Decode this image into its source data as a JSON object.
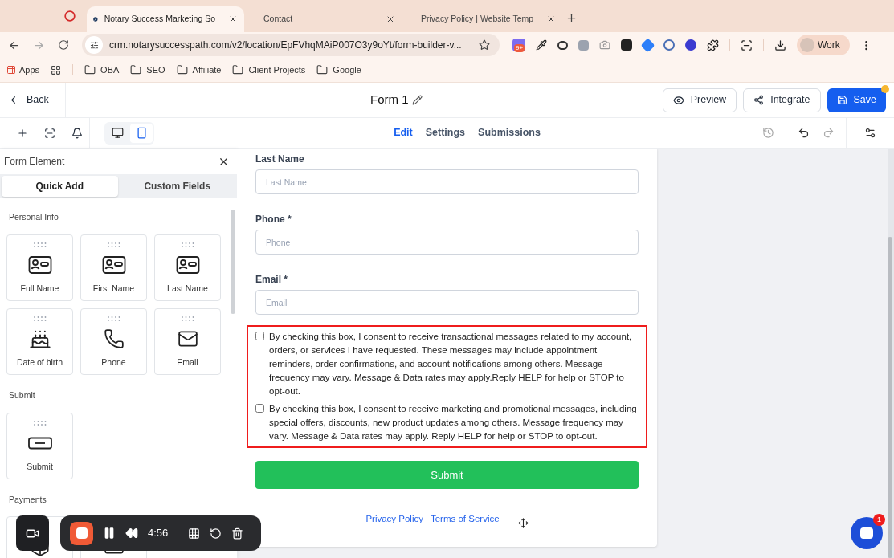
{
  "browser": {
    "tabs": [
      {
        "title": "Notary Success Marketing So",
        "selected": true
      },
      {
        "title": "Contact",
        "selected": false
      },
      {
        "title": "Privacy Policy | Website Temp",
        "selected": false
      }
    ],
    "url": "crm.notarysuccesspath.com/v2/location/EpFVhqMAiP007O3y9oYt/form-builder-v...",
    "extension_badge": "9+",
    "profile": "Work",
    "bookmarks": [
      {
        "label": "Apps",
        "kind": "apps"
      },
      {
        "label": "OBA",
        "kind": "folder"
      },
      {
        "label": "SEO",
        "kind": "folder"
      },
      {
        "label": "Affiliate",
        "kind": "folder"
      },
      {
        "label": "Client Projects",
        "kind": "folder"
      },
      {
        "label": "Google",
        "kind": "folder"
      }
    ]
  },
  "header": {
    "back": "Back",
    "title": "Form 1",
    "buttons": [
      {
        "label": "Preview",
        "kind": "preview"
      },
      {
        "label": "Integrate",
        "kind": "integrate"
      },
      {
        "label": "Save",
        "kind": "save"
      }
    ],
    "unsaved": true
  },
  "toolbar": {
    "devices": [
      {
        "kind": "desktop",
        "selected": false
      },
      {
        "kind": "mobile",
        "selected": true
      }
    ],
    "tabs": [
      {
        "label": "Edit",
        "selected": true
      },
      {
        "label": "Settings",
        "selected": false
      },
      {
        "label": "Submissions",
        "selected": false
      }
    ]
  },
  "panel": {
    "title": "Form Element",
    "tabs": [
      {
        "label": "Quick Add",
        "selected": true
      },
      {
        "label": "Custom Fields",
        "selected": false
      }
    ],
    "sections": [
      {
        "title": "Personal Info",
        "items": [
          {
            "label": "Full Name",
            "kind": "name"
          },
          {
            "label": "First Name",
            "kind": "name"
          },
          {
            "label": "Last Name",
            "kind": "name"
          },
          {
            "label": "Date of birth",
            "kind": "date"
          },
          {
            "label": "Phone",
            "kind": "phone"
          },
          {
            "label": "Email",
            "kind": "email"
          }
        ]
      },
      {
        "title": "Submit",
        "items": [
          {
            "label": "Submit",
            "kind": "submit"
          }
        ]
      },
      {
        "title": "Payments",
        "items": [
          {
            "kind": "product"
          },
          {
            "kind": "payment"
          }
        ]
      }
    ]
  },
  "form": {
    "fields": [
      {
        "label": "Last Name",
        "placeholder": "Last Name"
      },
      {
        "label": "Phone *",
        "placeholder": "Phone"
      },
      {
        "label": "Email *",
        "placeholder": "Email"
      }
    ],
    "consents": [
      {
        "text": "By checking this box, I consent to receive transactional messages related to my account, orders, or services I have requested. These messages may include appointment reminders, order confirmations, and account notifications among others. Message frequency may vary. Message & Data rates may apply.Reply HELP for help or STOP to opt-out.",
        "checked": false
      },
      {
        "text": "By checking this box, I consent to receive marketing and promotional messages, including special offers, discounts, new product updates among others. Message frequency may vary. Message & Data rates may apply. Reply HELP for help or STOP to opt-out.",
        "checked": false
      }
    ],
    "submit": "Submit",
    "links": [
      "Privacy Policy",
      "Terms of Service"
    ],
    "separator": "|"
  },
  "recorder": {
    "time": "4:56"
  },
  "chat": {
    "badge": "1"
  }
}
